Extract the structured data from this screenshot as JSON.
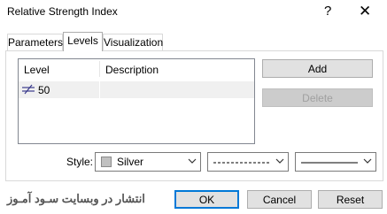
{
  "window": {
    "title": "Relative Strength Index",
    "help_glyph": "?",
    "close_glyph": "✕"
  },
  "tabs": [
    {
      "label": "Parameters"
    },
    {
      "label": "Levels"
    },
    {
      "label": "Visualization"
    }
  ],
  "levels_table": {
    "headers": {
      "level": "Level",
      "description": "Description"
    },
    "rows": [
      {
        "level": "50",
        "description": ""
      }
    ]
  },
  "buttons": {
    "add": "Add",
    "delete": "Delete",
    "ok": "OK",
    "cancel": "Cancel",
    "reset": "Reset"
  },
  "style": {
    "label": "Style:",
    "color": {
      "name": "Silver",
      "hex": "#c0c0c0"
    },
    "line_style": "dashed",
    "line_width": "solid"
  },
  "watermark": "انتشار در وبسایت سـود آمـوز",
  "colors": {
    "accent": "#0078d7",
    "row_highlight": "#f0f0f0"
  }
}
